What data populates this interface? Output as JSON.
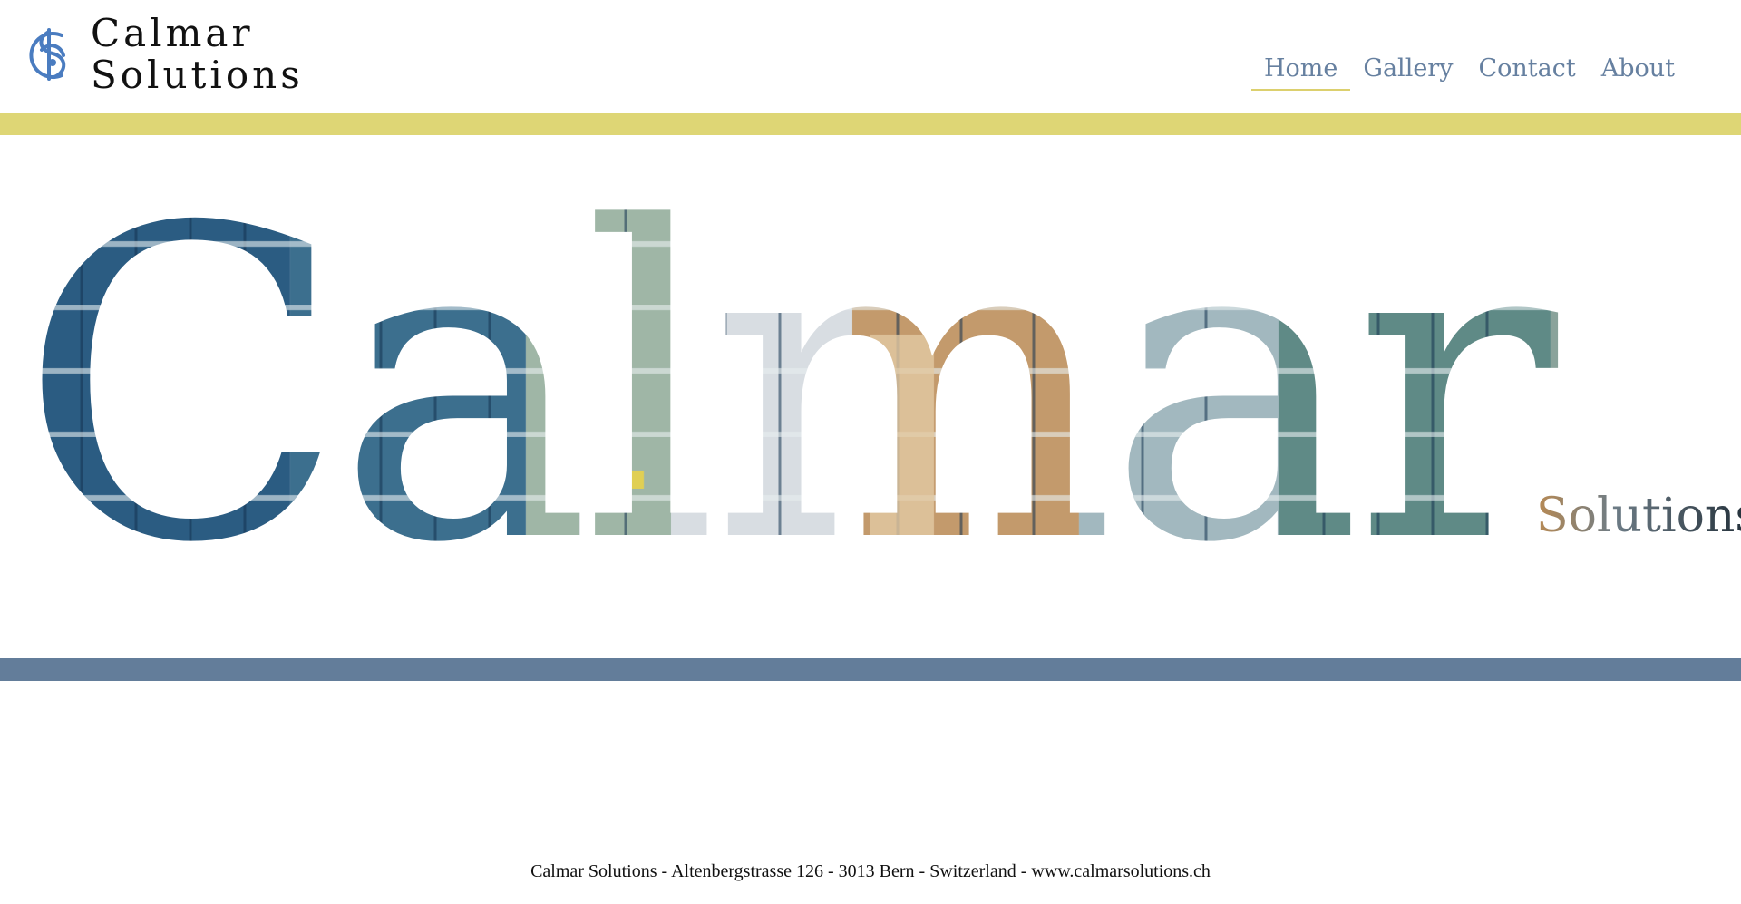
{
  "brand": {
    "name_line1": "Calmar",
    "name_line2": "Solutions",
    "logo_icon": "calmar-monogram-icon",
    "accent_color": "#ded675",
    "secondary_color": "#637d9a"
  },
  "nav": {
    "items": [
      {
        "label": "Home",
        "active": true
      },
      {
        "label": "Gallery",
        "active": false
      },
      {
        "label": "Contact",
        "active": false
      },
      {
        "label": "About",
        "active": false
      }
    ]
  },
  "hero": {
    "title": "Calmar",
    "subtitle": "Solutions"
  },
  "footer": {
    "text": "Calmar Solutions - Altenbergstrasse 126 - 3013 Bern - Switzerland - www.calmarsolutions.ch"
  }
}
